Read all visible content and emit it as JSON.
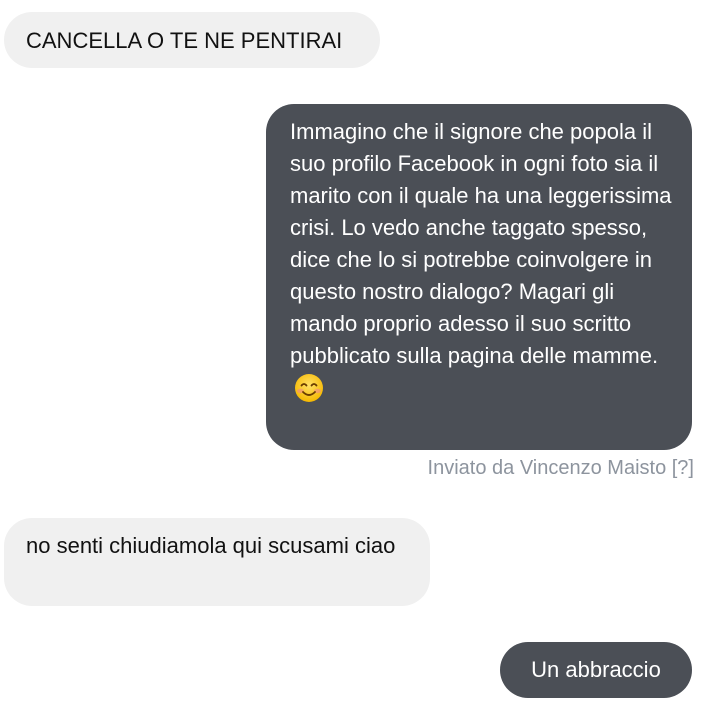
{
  "messages": [
    {
      "direction": "incoming",
      "text": "CANCELLA O TE NE PENTIRAI"
    },
    {
      "direction": "outgoing",
      "text": "Immagino che il signore che popola il suo profilo Facebook in ogni foto sia il marito con il quale ha una leggerissima crisi. Lo vedo anche taggato spesso, dice che lo si potrebbe coinvolgere in questo nostro dialogo? Magari gli mando proprio adesso il suo scritto pubblicato sulla pagina delle mamme.",
      "emoji": "smiling-face-icon"
    },
    {
      "direction": "incoming",
      "text": "no senti chiudiamola qui scusami ciao"
    },
    {
      "direction": "outgoing",
      "text": "Un abbraccio"
    }
  ],
  "meta": {
    "sent_by": "Inviato da Vincenzo Maisto [?]"
  },
  "colors": {
    "incoming_bg": "#f0f0f0",
    "outgoing_bg": "#4b4f56",
    "meta_text": "#8d949e"
  }
}
